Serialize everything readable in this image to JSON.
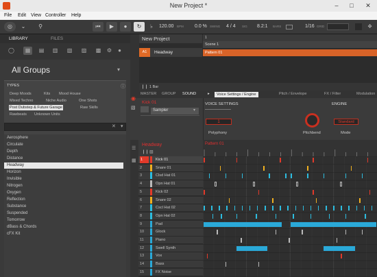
{
  "window": {
    "title": "New Project *"
  },
  "menu": [
    "File",
    "Edit",
    "View",
    "Controller",
    "Help"
  ],
  "transport": {
    "tempo": "120.00",
    "tempo_unit": "BPM",
    "swing": "0.0 %",
    "swing_label": "SWING",
    "signature": "4 / 4",
    "sig_label": "SIG",
    "position": "8.2:1",
    "pos_label": "BARS",
    "grid": "1/16",
    "grid_label": "GRID"
  },
  "library": {
    "tabs": [
      "LIBRARY",
      "FILES"
    ],
    "title": "All Groups",
    "types_label": "TYPES",
    "tags": [
      "Deep Moods",
      "Kits",
      "Mood House",
      "Mixed Techno",
      "Niche Audio",
      "One Shots",
      "Post Dubstep & Future Garage",
      "Raw Skills",
      "Rawbeats",
      "Unknown Units"
    ],
    "items": [
      "Aerosphere",
      "Circulate",
      "Depth",
      "Distance",
      "Headway",
      "Horizon",
      "Invisible",
      "Nitrogen",
      "Oxygen",
      "Reflection",
      "Substance",
      "Suspended",
      "Tomorrow",
      "dBass & Chords",
      "cFX Kit"
    ],
    "selected": "Headway"
  },
  "arranger": {
    "title": "New Project",
    "scene": "Scene 1",
    "group_id": "A1",
    "group_name": "Headway",
    "pattern": "Pattern 01",
    "bar_label": "1 Bar"
  },
  "control": {
    "tabs": [
      "MASTER",
      "GROUP",
      "SOUND"
    ],
    "kick_label": "Kick 01",
    "plugin": "Sampler",
    "pages": [
      "Voice Settings / Engine",
      "Pitch / Envelope",
      "FX / Filter",
      "Modulation"
    ],
    "voice_settings": "VOICE SETTINGS",
    "engine": "ENGINE",
    "polyphony_value": "1",
    "polyphony_label": "Polyphony",
    "pitchbend_label": "Pitchbend",
    "mode_value": "Standard",
    "mode_label": "Mode"
  },
  "sequencer": {
    "group": "Headway",
    "pattern": "Pattern 01",
    "sounds": [
      {
        "num": "1",
        "name": "Kick 01",
        "color": "#e23a2a"
      },
      {
        "num": "2",
        "name": "Snare 01",
        "color": "#f0b020"
      },
      {
        "num": "3",
        "name": "Clsd Hat 01",
        "color": "#2dbde0"
      },
      {
        "num": "4",
        "name": "Opn Hat 01",
        "color": "#bbbbbb"
      },
      {
        "num": "5",
        "name": "Kick 02",
        "color": "#e23a2a"
      },
      {
        "num": "6",
        "name": "Snare 02",
        "color": "#f0b020"
      },
      {
        "num": "7",
        "name": "Cscl Hat 02",
        "color": "#2dbde0"
      },
      {
        "num": "8",
        "name": "Opn Hat 02",
        "color": "#2dbde0"
      },
      {
        "num": "9",
        "name": "Pad",
        "color": "#2aa9d8"
      },
      {
        "num": "10",
        "name": "Glock",
        "color": "#2aa9d8"
      },
      {
        "num": "11",
        "name": "Piano",
        "color": "#2aa9d8"
      },
      {
        "num": "12",
        "name": "Swell Synth",
        "color": "#2aa9d8"
      },
      {
        "num": "13",
        "name": "Vox",
        "color": "#2aa9d8"
      },
      {
        "num": "14",
        "name": "Bass",
        "color": "#2aa9d8"
      },
      {
        "num": "15",
        "name": "FX Noise",
        "color": "#2aa9d8"
      }
    ]
  }
}
